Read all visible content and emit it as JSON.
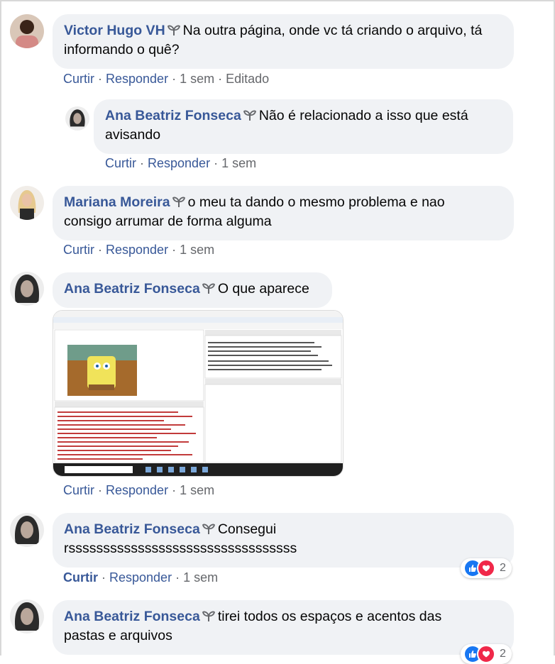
{
  "comments": [
    {
      "author": "Victor Hugo VH",
      "text_line1": "Na outra página, onde vc tá criando o arquivo, tá",
      "text_line2": "informando o quê?",
      "actions": {
        "like": "Curtir",
        "reply": "Responder",
        "time": "1 sem",
        "edited": "Editado"
      }
    },
    {
      "author": "Ana Beatriz Fonseca",
      "text_line1": "Não é relacionado a isso que está",
      "text_line2": "avisando",
      "actions": {
        "like": "Curtir",
        "reply": "Responder",
        "time": "1 sem"
      }
    },
    {
      "author": "Mariana Moreira",
      "text_line1": "o meu ta dando o mesmo problema e nao",
      "text_line2": "consigo arrumar de forma alguma",
      "actions": {
        "like": "Curtir",
        "reply": "Responder",
        "time": "1 sem"
      }
    },
    {
      "author": "Ana Beatriz Fonseca",
      "text_line1": "O que aparece",
      "actions": {
        "like": "Curtir",
        "reply": "Responder",
        "time": "1 sem"
      },
      "attachment": "screenshot"
    },
    {
      "author": "Ana Beatriz Fonseca",
      "text_line1": "Consegui",
      "text_line2": "rsssssssssssssssssssssssssssssssss",
      "actions": {
        "like": "Curtir",
        "reply": "Responder",
        "time": "1 sem"
      },
      "reactions": {
        "count": "2",
        "types": [
          "like-icon",
          "love-icon"
        ]
      }
    },
    {
      "author": "Ana Beatriz Fonseca",
      "text_line1": "tirei todos os espaços e acentos das",
      "text_line2": "pastas e arquivos",
      "reactions": {
        "count": "2"
      }
    }
  ],
  "colors": {
    "author": "#385898",
    "bubble": "#f0f2f5",
    "meta": "#65676b",
    "like": "#1877f2",
    "love": "#f02849"
  }
}
